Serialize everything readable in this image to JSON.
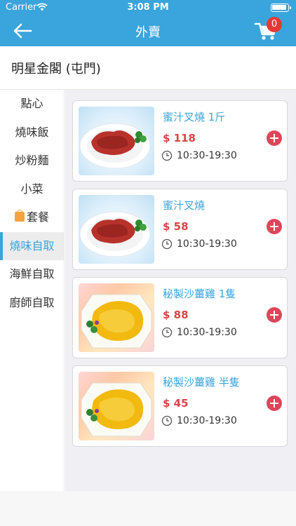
{
  "status": {
    "carrier": "Carrier",
    "time": "3:08 PM"
  },
  "nav": {
    "title": "外賣",
    "back_icon": "back-arrow-icon",
    "cart_icon": "cart-icon",
    "cart_count": "0"
  },
  "store": {
    "name": "明星金閣 (屯門)"
  },
  "categories": [
    {
      "label": "點心"
    },
    {
      "label": "燒味飯"
    },
    {
      "label": "炒粉麵"
    },
    {
      "label": "小菜"
    },
    {
      "label": "套餐",
      "icon": "bag-icon"
    },
    {
      "label": "燒味自取",
      "active": true
    },
    {
      "label": "海鮮自取"
    },
    {
      "label": "廚師自取"
    }
  ],
  "items": [
    {
      "name": "蜜汁叉燒 1斤",
      "price": "$ 118",
      "hours": "10:30-19:30",
      "image": "char-siu-photo"
    },
    {
      "name": "蜜汁叉燒",
      "price": "$ 58",
      "hours": "10:30-19:30",
      "image": "char-siu-photo"
    },
    {
      "name": "秘製沙薑雞 1隻",
      "price": "$ 88",
      "hours": "10:30-19:30",
      "image": "sand-ginger-chicken-photo"
    },
    {
      "name": "秘製沙薑雞 半隻",
      "price": "$ 45",
      "hours": "10:30-19:30",
      "image": "sand-ginger-chicken-photo"
    }
  ],
  "colors": {
    "accent": "#3aa4dc",
    "price": "#d64545",
    "add_button": "#e0455a",
    "badge": "#e53935"
  }
}
